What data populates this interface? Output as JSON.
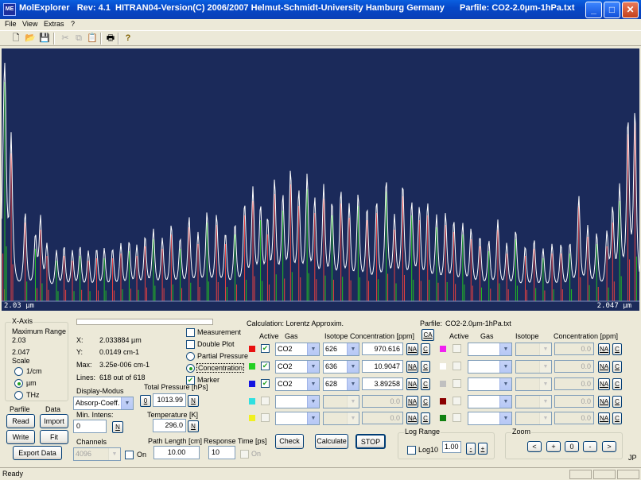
{
  "window": {
    "app_icon_text": "ME",
    "title": "MolExplorer   Rev: 4.1  HITRAN04-Version(C) 2006/2007 Helmut-Schmidt-University Hamburg Germany",
    "parfile_title": "Parfile: CO2-2.0µm-1hPa.txt",
    "minimize": "_",
    "maximize": "□",
    "close": "✕"
  },
  "menu": [
    "File",
    "View",
    "Extras",
    "?"
  ],
  "toolbar": {
    "icons": [
      "new-file-icon",
      "open-folder-icon",
      "save-disk-icon",
      "cut-icon",
      "copy-icon",
      "paste-icon",
      "print-icon",
      "help-icon"
    ]
  },
  "plot": {
    "x_min_label": "2.03  µm",
    "x_max_label": "2.047  µm",
    "background": "#1b2a5a",
    "colors": {
      "series1": "#e84040",
      "series2": "#22c022",
      "series3": "#ffffff",
      "envelope": "#ffffff"
    }
  },
  "chart_data": {
    "type": "line",
    "xlim": [
      2.03,
      2.047
    ],
    "x_unit": "µm",
    "envelope_peaks_x": [
      0.2,
      0.5,
      1.5,
      3.7,
      5.3,
      6.1,
      7.1,
      8.6,
      9.8,
      11.1,
      12.3,
      13.6,
      14.9,
      16.1,
      17.4,
      18.7,
      20.0,
      21.2,
      22.5,
      23.8,
      25.2,
      26.6,
      28.0,
      29.4,
      30.8,
      32.2,
      33.7,
      35.1,
      36.6,
      38.1,
      39.4,
      40.6,
      41.7,
      42.8,
      44.1,
      45.3,
      46.6,
      47.9,
      49.1,
      50.5,
      51.8,
      53.2,
      54.5,
      55.9,
      57.3,
      58.8,
      60.3,
      61.6,
      62.9,
      64.3,
      65.5,
      66.8,
      68.2,
      69.6,
      70.9,
      72.3,
      73.6,
      75.0,
      76.4,
      77.8,
      79.2,
      80.6,
      82.1,
      83.5,
      84.9,
      86.3,
      87.7,
      89.1,
      90.5,
      91.9,
      93.3,
      94.9,
      95.8,
      96.9,
      98.2,
      99.3
    ],
    "envelope_peaks_y": [
      0.2,
      0.92,
      0.62,
      0.33,
      0.22,
      0.3,
      0.19,
      0.17,
      0.19,
      0.17,
      0.19,
      0.17,
      0.18,
      0.18,
      0.18,
      0.2,
      0.21,
      0.19,
      0.23,
      0.26,
      0.22,
      0.28,
      0.22,
      0.31,
      0.24,
      0.33,
      0.32,
      0.24,
      0.28,
      0.36,
      0.42,
      0.34,
      0.28,
      0.45,
      0.38,
      0.49,
      0.4,
      0.47,
      0.37,
      0.43,
      0.36,
      0.41,
      0.35,
      0.4,
      0.34,
      0.37,
      0.46,
      0.3,
      0.44,
      0.36,
      0.34,
      0.36,
      0.31,
      0.32,
      0.29,
      0.28,
      0.26,
      0.23,
      0.21,
      0.3,
      0.2,
      0.26,
      0.19,
      0.22,
      0.18,
      0.2,
      0.2,
      0.2,
      0.4,
      0.27,
      0.24,
      0.23,
      0.33,
      0.42,
      0.7,
      0.75
    ]
  },
  "xaxis": {
    "group_title": "X-Axis",
    "max_range_label": "Maximum Range",
    "max_range_min": "2.03",
    "max_range_max": "2.047",
    "scale_label": "Scale",
    "scale_options": [
      "1/cm",
      "µm",
      "THz"
    ],
    "scale_selected": 1
  },
  "parfile_data": {
    "parfile_label": "Parfile",
    "data_label": "Data",
    "read": "Read",
    "import": "Import",
    "write": "Write",
    "fit": "Fit",
    "export": "Export Data"
  },
  "info": {
    "x_label": "X:",
    "x_value": "2.033884 µm",
    "y_label": "Y:",
    "y_value": "0.0149 cm-1",
    "max_label": "Max:",
    "max_value": "3.25e-006 cm-1",
    "lines_label": "Lines:",
    "lines_value": "618 out of 618"
  },
  "display": {
    "modus_label": "Display-Modus",
    "modus_value": "Absorp-Coeff.",
    "min_intens_label": "Min. Intens:",
    "min_intens_value": "0",
    "channels_label": "Channels",
    "channels_value": "4096",
    "on_label": "On",
    "n_label": "N",
    "zero_label": "0"
  },
  "physics": {
    "total_pressure_label": "Total Pressure [hPs]",
    "total_pressure_value": "1013.99",
    "temperature_label": "Temperature [K]",
    "temperature_value": "296.0",
    "path_length_label": "Path Length [cm]",
    "path_length_value": "10.00",
    "response_time_label": "Response Time [ps]",
    "response_time_value": "10",
    "response_on_label": "On"
  },
  "options": {
    "measurement": "Measurement",
    "double_plot": "Double Plot",
    "partial_pressure": "Partial Pressure",
    "concentration": "Concentration",
    "marker": "Marker"
  },
  "calc": {
    "title": "Calculation: Lorentz Approxim.",
    "active_header": "Active",
    "gas_header": "Gas",
    "isotope_header": "Isotope",
    "conc_header": "Concentration [ppm]",
    "parfile_label": "Parfile:",
    "parfile_value": "CO2-2.0µm-1hPa.txt",
    "ca_label": "CA",
    "na_label": "NA",
    "c_label": "C",
    "rows_left": [
      {
        "color": "#e81010",
        "active": true,
        "gas": "CO2",
        "isotope": "626",
        "conc": "970.616"
      },
      {
        "color": "#22d022",
        "active": true,
        "gas": "CO2",
        "isotope": "636",
        "conc": "10.9047"
      },
      {
        "color": "#1414e0",
        "active": true,
        "gas": "CO2",
        "isotope": "628",
        "conc": "3.89258"
      },
      {
        "color": "#30e0e0",
        "active": false,
        "gas": "",
        "isotope": "",
        "conc": "0.0"
      },
      {
        "color": "#f0f020",
        "active": false,
        "gas": "",
        "isotope": "",
        "conc": "0.0"
      }
    ],
    "rows_right": [
      {
        "color": "#f020f0",
        "conc": "0.0"
      },
      {
        "color": "#ffffff",
        "conc": "0.0"
      },
      {
        "color": "#c0c0c0",
        "conc": "0.0"
      },
      {
        "color": "#8b0000",
        "conc": "0.0"
      },
      {
        "color": "#108010",
        "conc": "0.0"
      }
    ]
  },
  "actions": {
    "check": "Check",
    "calculate": "Calculate",
    "stop": "STOP"
  },
  "log_range": {
    "title": "Log Range",
    "log10_label": "Log10",
    "value": "1.00",
    "minus": "-",
    "plus": "+"
  },
  "zoom": {
    "title": "Zoom",
    "buttons": [
      "<",
      "+",
      "0",
      "-",
      ">"
    ]
  },
  "jp_label": "JP",
  "status": {
    "text": "Ready"
  }
}
